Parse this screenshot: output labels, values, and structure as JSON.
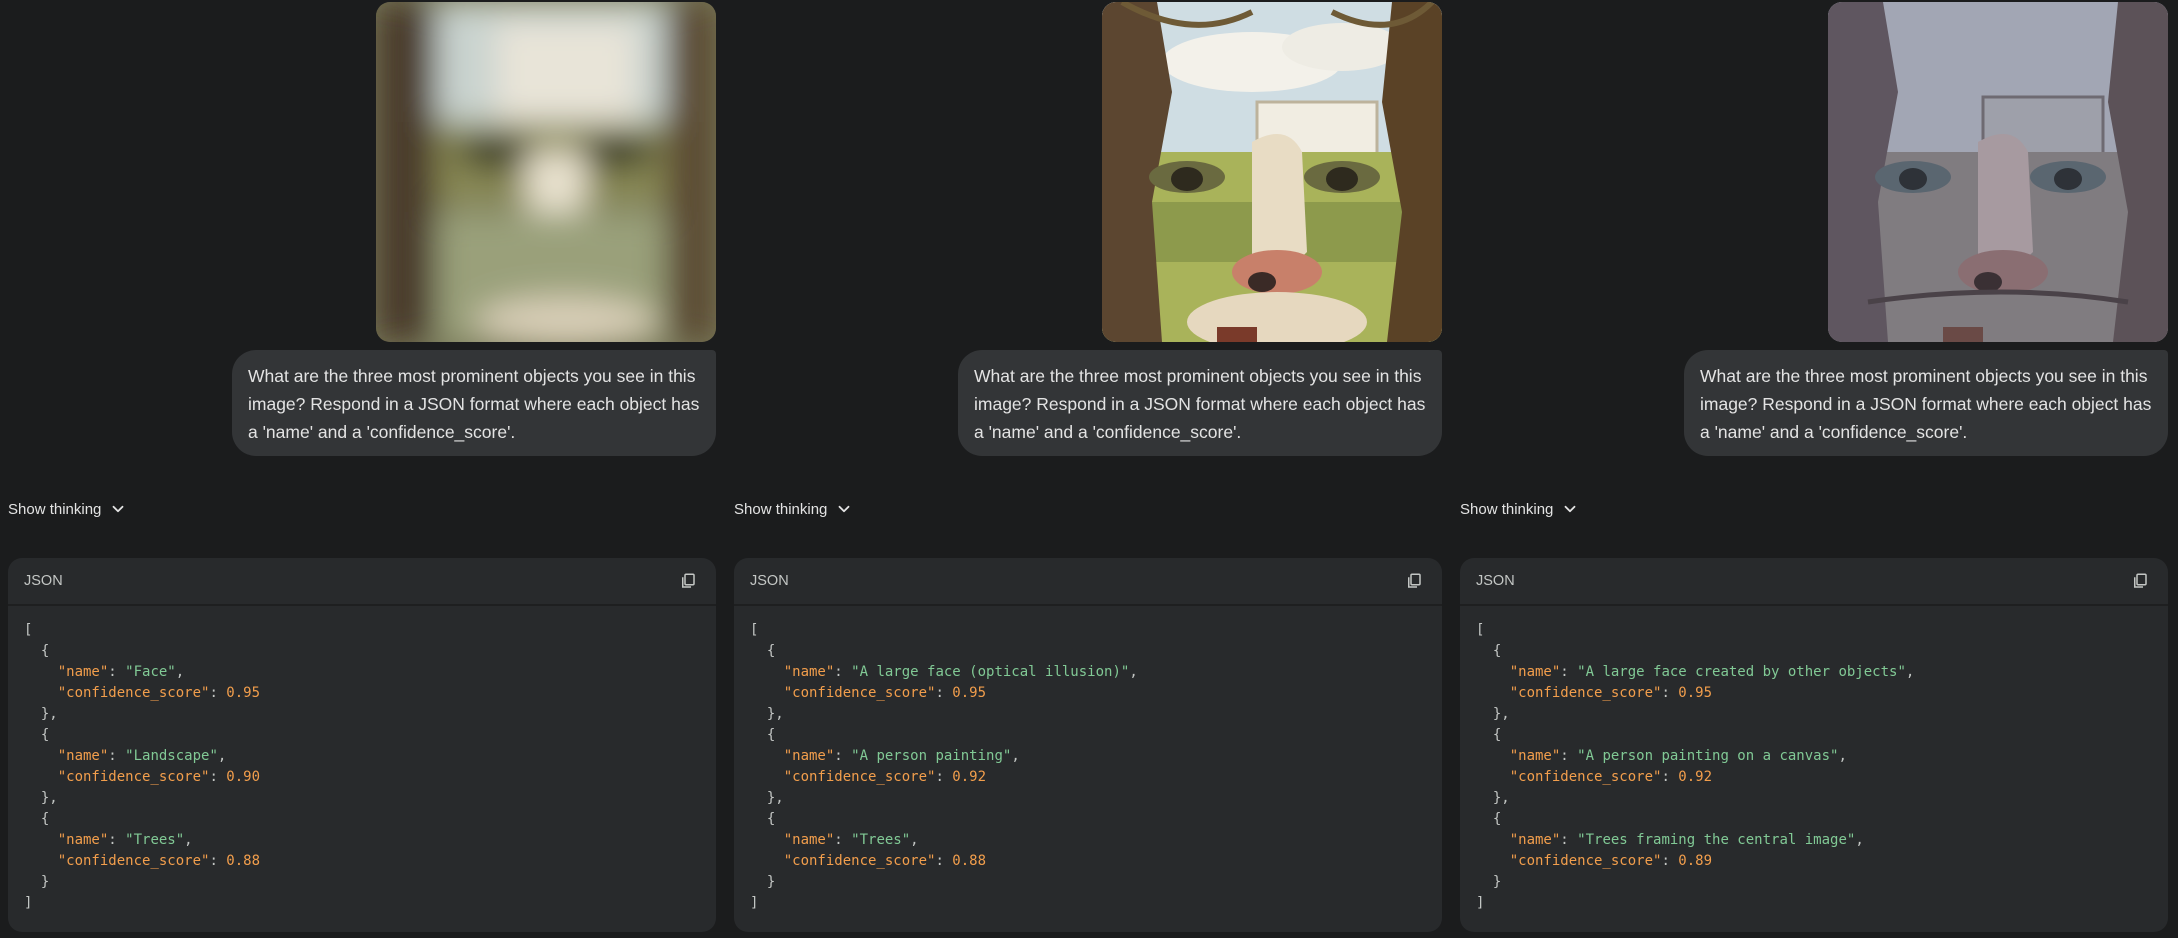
{
  "panels": [
    {
      "prompt": "What are the three most prominent objects you see in this image? Respond in a JSON format where each object has a 'name' and a 'confidence_score'.",
      "show_thinking": "Show thinking",
      "code_lang": "JSON",
      "objects": [
        {
          "name": "\"Face\"",
          "score": "0.95"
        },
        {
          "name": "\"Landscape\"",
          "score": "0.90"
        },
        {
          "name": "\"Trees\"",
          "score": "0.88"
        }
      ]
    },
    {
      "prompt": "What are the three most prominent objects you see in this image? Respond in a JSON format where each object has a 'name' and a 'confidence_score'.",
      "show_thinking": "Show thinking",
      "code_lang": "JSON",
      "objects": [
        {
          "name": "\"A large face (optical illusion)\"",
          "score": "0.95"
        },
        {
          "name": "\"A person painting\"",
          "score": "0.92"
        },
        {
          "name": "\"Trees\"",
          "score": "0.88"
        }
      ]
    },
    {
      "prompt": "What are the three most prominent objects you see in this image? Respond in a JSON format where each object has a 'name' and a 'confidence_score'.",
      "show_thinking": "Show thinking",
      "code_lang": "JSON",
      "objects": [
        {
          "name": "\"A large face created by other objects\"",
          "score": "0.95"
        },
        {
          "name": "\"A person painting on a canvas\"",
          "score": "0.92"
        },
        {
          "name": "\"Trees framing the central image\"",
          "score": "0.89"
        }
      ]
    }
  ],
  "code_keys": {
    "name": "\"name\"",
    "confidence_score": "\"confidence_score\""
  },
  "icons": {
    "chevron": "chevron-down-icon",
    "copy": "copy-icon"
  },
  "colors": {
    "background": "#1b1c1d",
    "prompt_bubble": "#333537",
    "code_bg": "#282a2c",
    "json_key": "#f29e4c",
    "json_string": "#81c995",
    "json_number": "#f29e4c"
  }
}
